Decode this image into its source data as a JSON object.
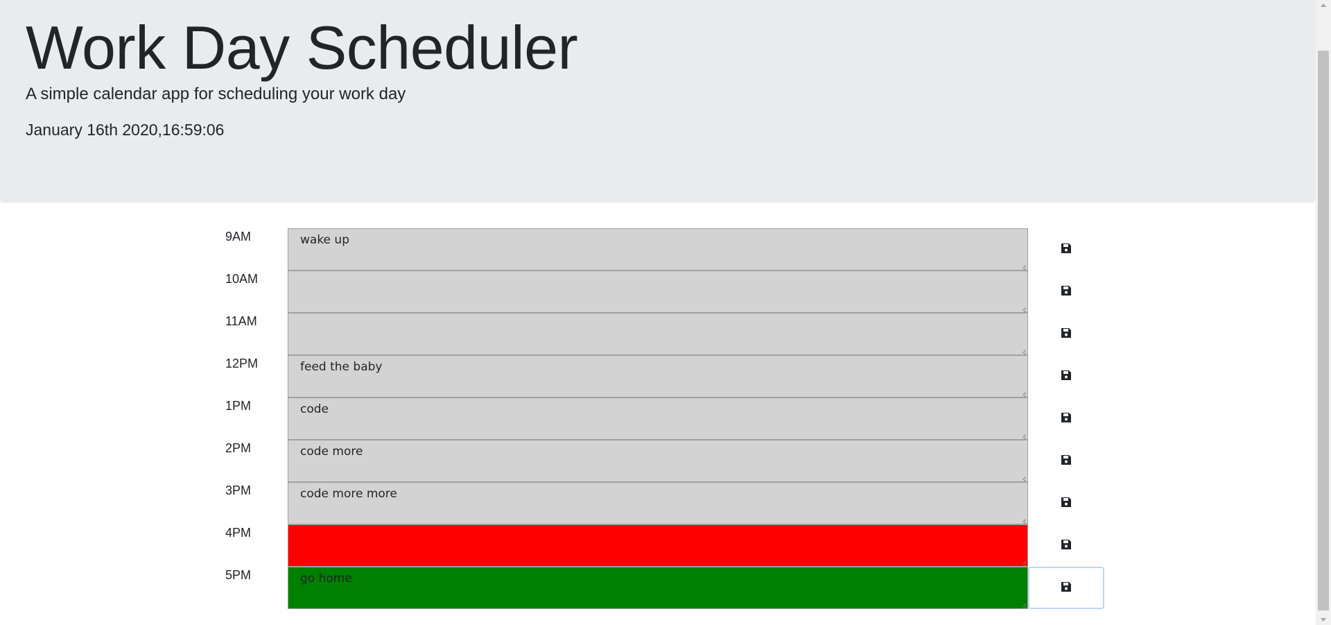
{
  "header": {
    "title": "Work Day Scheduler",
    "subtitle": "A simple calendar app for scheduling your work day",
    "current_datetime": "January 16th 2020,16:59:06"
  },
  "colors": {
    "past": "#d3d3d3",
    "present": "#ff0000",
    "future": "#008000",
    "header_bg": "#e9ecef"
  },
  "schedule": {
    "rows": [
      {
        "hour": "9AM",
        "text": "wake up",
        "status": "past"
      },
      {
        "hour": "10AM",
        "text": "",
        "status": "past"
      },
      {
        "hour": "11AM",
        "text": "",
        "status": "past"
      },
      {
        "hour": "12PM",
        "text": "feed the baby",
        "status": "past"
      },
      {
        "hour": "1PM",
        "text": "code",
        "status": "past"
      },
      {
        "hour": "2PM",
        "text": "code more",
        "status": "past"
      },
      {
        "hour": "3PM",
        "text": "code more more",
        "status": "past"
      },
      {
        "hour": "4PM",
        "text": "",
        "status": "present"
      },
      {
        "hour": "5PM",
        "text": "go home",
        "status": "future"
      }
    ],
    "save_icon": "floppy-disk-icon"
  }
}
